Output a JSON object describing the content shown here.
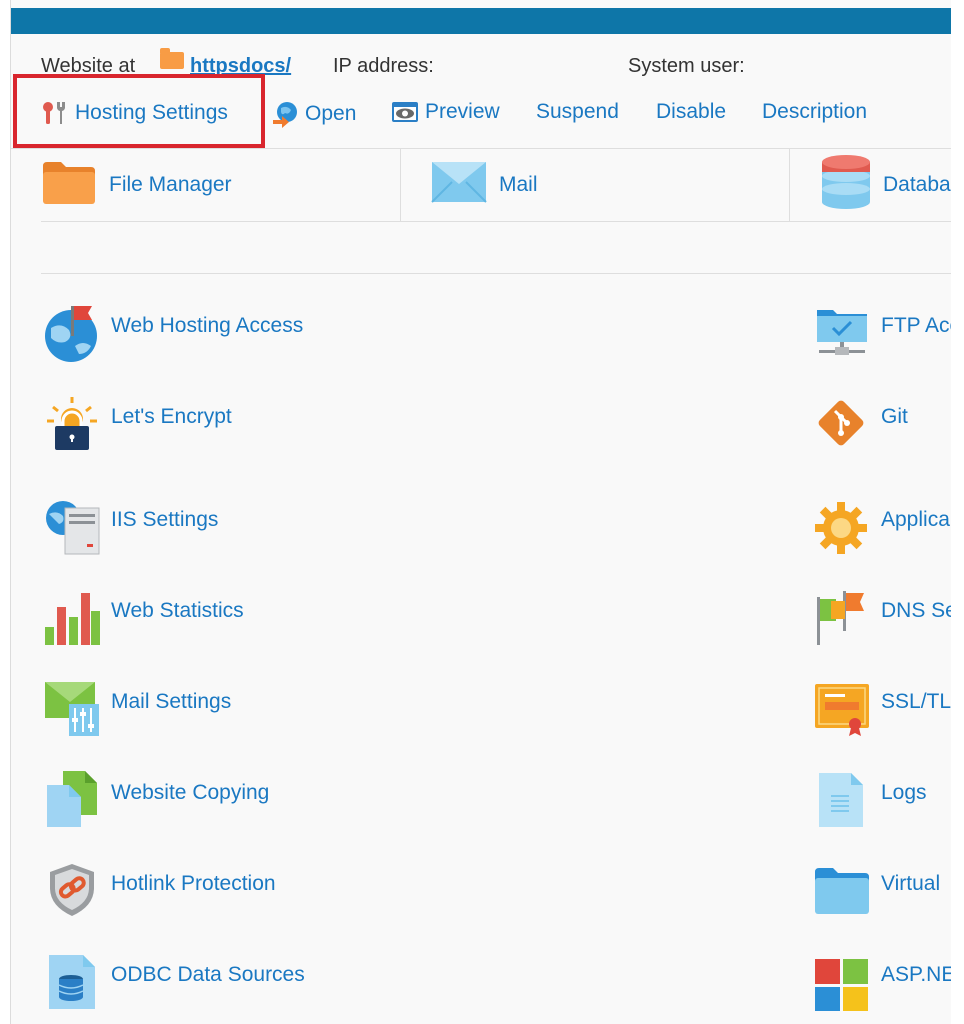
{
  "header": {
    "website_at_label": "Website at",
    "domain_link": "httpsdocs/",
    "ip_label": "IP address:",
    "system_user_label": "System user:"
  },
  "actions": [
    {
      "label": "Hosting Settings",
      "icon": "wrench-icon"
    },
    {
      "label": "Open",
      "icon": "globe-arrow-icon"
    },
    {
      "label": "Preview",
      "icon": "eye-icon"
    },
    {
      "label": "Suspend"
    },
    {
      "label": "Disable"
    },
    {
      "label": "Description"
    }
  ],
  "tiles": [
    {
      "label": "File Manager",
      "icon": "folder-icon"
    },
    {
      "label": "Mail",
      "icon": "envelope-icon"
    },
    {
      "label": "Databa",
      "icon": "database-icon"
    }
  ],
  "left_list": [
    {
      "label": "Web Hosting Access",
      "icon": "globe-flag-icon"
    },
    {
      "label": "Let's Encrypt",
      "icon": "lock-sun-icon"
    },
    {
      "label": "IIS Settings",
      "icon": "server-globe-icon"
    },
    {
      "label": "Web Statistics",
      "icon": "bar-chart-icon"
    },
    {
      "label": "Mail Settings",
      "icon": "mail-settings-icon"
    },
    {
      "label": "Website Copying",
      "icon": "copy-pages-icon"
    },
    {
      "label": "Hotlink Protection",
      "icon": "shield-link-icon"
    },
    {
      "label": "ODBC Data Sources",
      "icon": "database-doc-icon"
    }
  ],
  "right_list": [
    {
      "label": "FTP Acc",
      "icon": "ftp-folder-icon"
    },
    {
      "label": "Git",
      "icon": "git-icon"
    },
    {
      "label": "Applica",
      "icon": "gear-icon"
    },
    {
      "label": "DNS Se",
      "icon": "flags-icon"
    },
    {
      "label": "SSL/TLS",
      "icon": "certificate-icon"
    },
    {
      "label": "Logs",
      "icon": "log-file-icon"
    },
    {
      "label": "Virtual",
      "icon": "folder-blue-icon"
    },
    {
      "label": "ASP.NE",
      "icon": "windows-icon"
    }
  ],
  "colors": {
    "link": "#1a78c2",
    "topbar": "#0e76a8",
    "highlight": "#d9262e"
  }
}
